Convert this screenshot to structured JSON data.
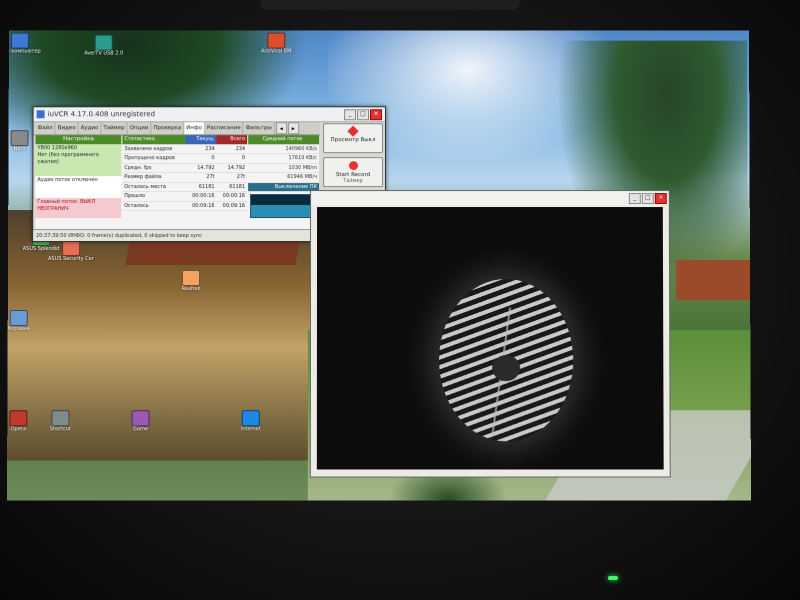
{
  "app": {
    "title": "iuVCR 4.17.0.408 unregistered",
    "tabs": [
      "Файл",
      "Видео",
      "Аудио",
      "Таймер",
      "Опции",
      "Проверка",
      "Инфо",
      "Расписание",
      "Фильтры"
    ],
    "active_tab": "Инфо",
    "tab_arrows": [
      "◂",
      "▸"
    ],
    "left_header": "Настройка",
    "left_lines_green": [
      "YB00 1280x960",
      "Нет (без программного",
      "сжатия)"
    ],
    "left_lines_white": [
      "Аудио поток отключен"
    ],
    "left_lines_pink": [
      "Главный поток: ВЫКЛ",
      "НЕОГРАНИЧ"
    ],
    "stats_headers": [
      "Статистика",
      "Текущ.",
      "Всего"
    ],
    "stats_rows": [
      [
        "Захвачено кадров",
        "234",
        "234"
      ],
      [
        "Пропущено кадров",
        "0",
        "0"
      ],
      [
        "Средн. fps",
        "14.792",
        "14.792"
      ],
      [
        "Размер файла",
        "27t",
        "27t"
      ],
      [
        "Осталось места",
        "61181",
        "61181"
      ],
      [
        "Прошло",
        "00:00:16",
        "00:00:16"
      ],
      [
        "Осталось",
        "00:09:16",
        "00:09:16"
      ]
    ],
    "flow_header": "Средний поток",
    "flow_rows": [
      "140960 KB/s",
      "17619 KB/c",
      "1030 MB/m",
      "61946 MB/ч"
    ],
    "flow_highlight": "Выключение ПК",
    "graph_level": 0.55,
    "buttons": {
      "view": "Просмотр Выкл",
      "record": "Start Record",
      "record_sub": "Таймер",
      "snapshot": "Снимок"
    },
    "status": "20:37:39:50 ИНФО: 0 frame(s) duplicated, 0 skipped to keep sync",
    "status_dropdown": "▾",
    "title_buttons": [
      "_",
      "□",
      "×"
    ],
    "side_arrow": "◂"
  },
  "preview": {
    "title_buttons": [
      "_",
      "□",
      "×"
    ]
  },
  "desktop_icons": [
    {
      "label": "Мой компьютер",
      "color": "#3a7bd5"
    },
    {
      "label": "AverTV USB 2.0",
      "color": "#2a9d8f"
    },
    {
      "label": "AntiViral BM",
      "color": "#d94f30"
    },
    {
      "label": "Nero",
      "color": "#8a8a8a"
    },
    {
      "label": "ASUS Splendid",
      "color": "#4caf50"
    },
    {
      "label": "ASUS Security Center",
      "color": "#e76f51"
    },
    {
      "label": "Realtek",
      "color": "#f4a261"
    },
    {
      "label": "Корзина",
      "color": "#6c9bd2"
    },
    {
      "label": "Opera",
      "color": "#c0392b"
    },
    {
      "label": "Shortcut",
      "color": "#7f8c8d"
    },
    {
      "label": "Game",
      "color": "#9b59b6"
    },
    {
      "label": "Internet",
      "color": "#1e88e5"
    }
  ]
}
